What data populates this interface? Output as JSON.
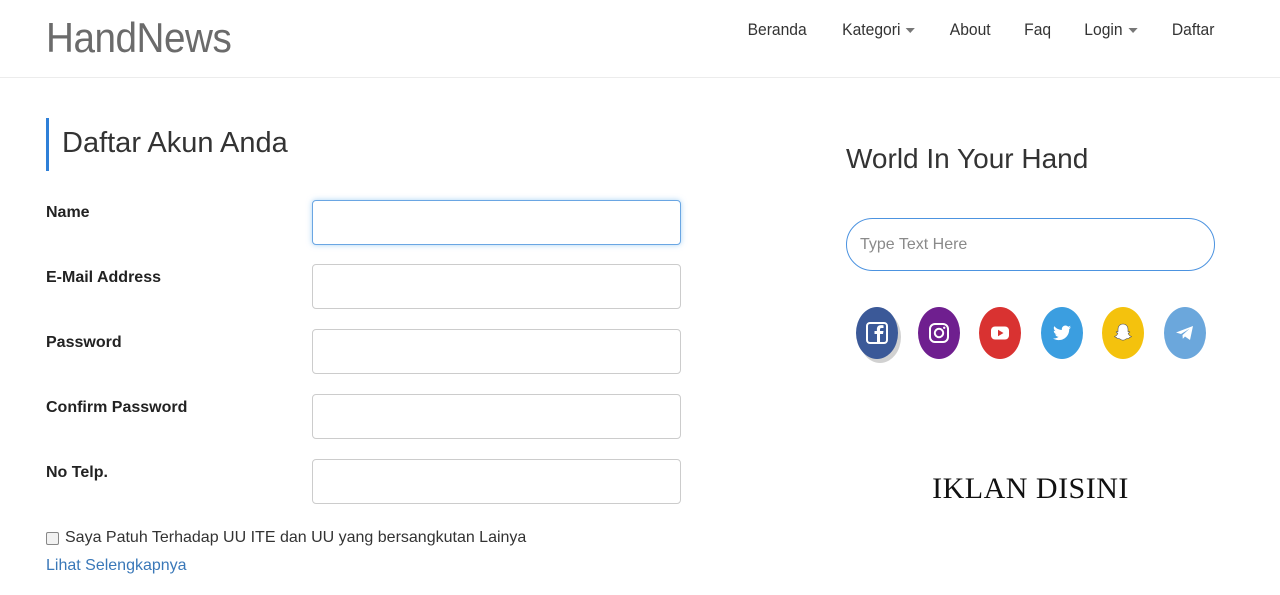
{
  "brand": {
    "name": "HandNews"
  },
  "nav": {
    "items": [
      {
        "label": "Beranda",
        "dropdown": false
      },
      {
        "label": "Kategori",
        "dropdown": true
      },
      {
        "label": "About",
        "dropdown": false
      },
      {
        "label": "Faq",
        "dropdown": false
      },
      {
        "label": "Login",
        "dropdown": true
      },
      {
        "label": "Daftar",
        "dropdown": false
      }
    ]
  },
  "form": {
    "heading": "Daftar Akun Anda",
    "fields": [
      {
        "label": "Name",
        "value": "",
        "focused": true
      },
      {
        "label": "E-Mail Address",
        "value": ""
      },
      {
        "label": "Password",
        "value": ""
      },
      {
        "label": "Confirm Password",
        "value": ""
      },
      {
        "label": "No Telp.",
        "value": ""
      }
    ],
    "terms_label": "Saya Patuh Terhadap UU ITE dan UU yang bersangkutan Lainya",
    "terms_checked": false,
    "more_link": "Lihat Selengkapnya"
  },
  "sidebar": {
    "title": "World In Your Hand",
    "search_placeholder": "Type Text Here",
    "socials": [
      "facebook-icon",
      "instagram-icon",
      "youtube-icon",
      "twitter-icon",
      "snapchat-icon",
      "telegram-icon"
    ],
    "ad_text": "IKLAN DISINI"
  },
  "colors": {
    "accent": "#2f80d8",
    "link": "#3a78b8",
    "facebook": "#3b5998",
    "instagram": "#6f1f8f",
    "youtube": "#d93231",
    "twitter": "#3b9ee0",
    "snapchat": "#f4c20d",
    "telegram": "#6ba7dc"
  }
}
